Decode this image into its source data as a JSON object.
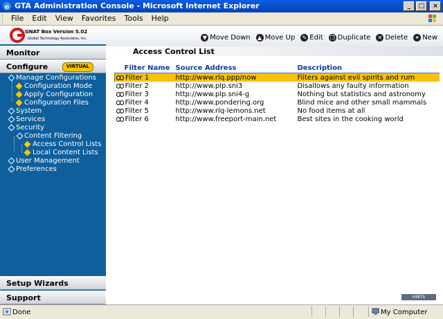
{
  "window": {
    "title": "GTA Administration Console - Microsoft Internet Explorer"
  },
  "menubar": {
    "items": [
      "File",
      "Edit",
      "View",
      "Favorites",
      "Tools",
      "Help"
    ]
  },
  "brand": {
    "product": "GNAT Box Version 5.02",
    "company": "Global Technology Associates, Inc."
  },
  "toolbar": {
    "move_down": "Move Down",
    "move_up": "Move Up",
    "edit": "Edit",
    "duplicate": "Duplicate",
    "delete": "Delete",
    "new": "New"
  },
  "sidebar": {
    "monitor": "Monitor",
    "configure": "Configure",
    "virtual_badge": "VIRTUAL",
    "setup_wizards": "Setup Wizards",
    "support": "Support",
    "tree": {
      "manage_configurations": "Manage Configurations",
      "configuration_mode": "Configuration Mode",
      "apply_configuration": "Apply Configuration",
      "configuration_files": "Configuration Files",
      "system": "System",
      "services": "Services",
      "security": "Security",
      "content_filtering": "Content Filtering",
      "access_control_lists": "Access Control Lists",
      "local_content_lists": "Local Content Lists",
      "user_management": "User Management",
      "preferences": "Preferences"
    }
  },
  "main": {
    "title": "Access Control List",
    "columns": [
      "Filter Name",
      "Source Address",
      "Description"
    ],
    "rows": [
      {
        "name": "Filter 1",
        "source": "http://www.rlq.ppp/now",
        "description": "Filters against evil spirits and rum",
        "selected": true
      },
      {
        "name": "Filter 2",
        "source": "http://www.plp.sni3",
        "description": "Disallows any faulty information"
      },
      {
        "name": "Filter 3",
        "source": "http://www.plp.sni4-g",
        "description": "Nothing but statistics and astronomy"
      },
      {
        "name": "Filter 4",
        "source": "http://www.pondering.org",
        "description": "Blind mice and other small mammals"
      },
      {
        "name": "Filter 5",
        "source": "http://www.rlq-lemons.net",
        "description": "No food items at all"
      },
      {
        "name": "Filter 6",
        "source": "http://www.freeport-main.net",
        "description": "Best sites in the cooking world"
      }
    ],
    "hints": "HINTS"
  },
  "statusbar": {
    "status": "Done",
    "zone": "My Computer"
  },
  "colors": {
    "selection": "#f8c10a",
    "sidebar": "#0e5f9c",
    "header_text": "#0b3d9a"
  }
}
